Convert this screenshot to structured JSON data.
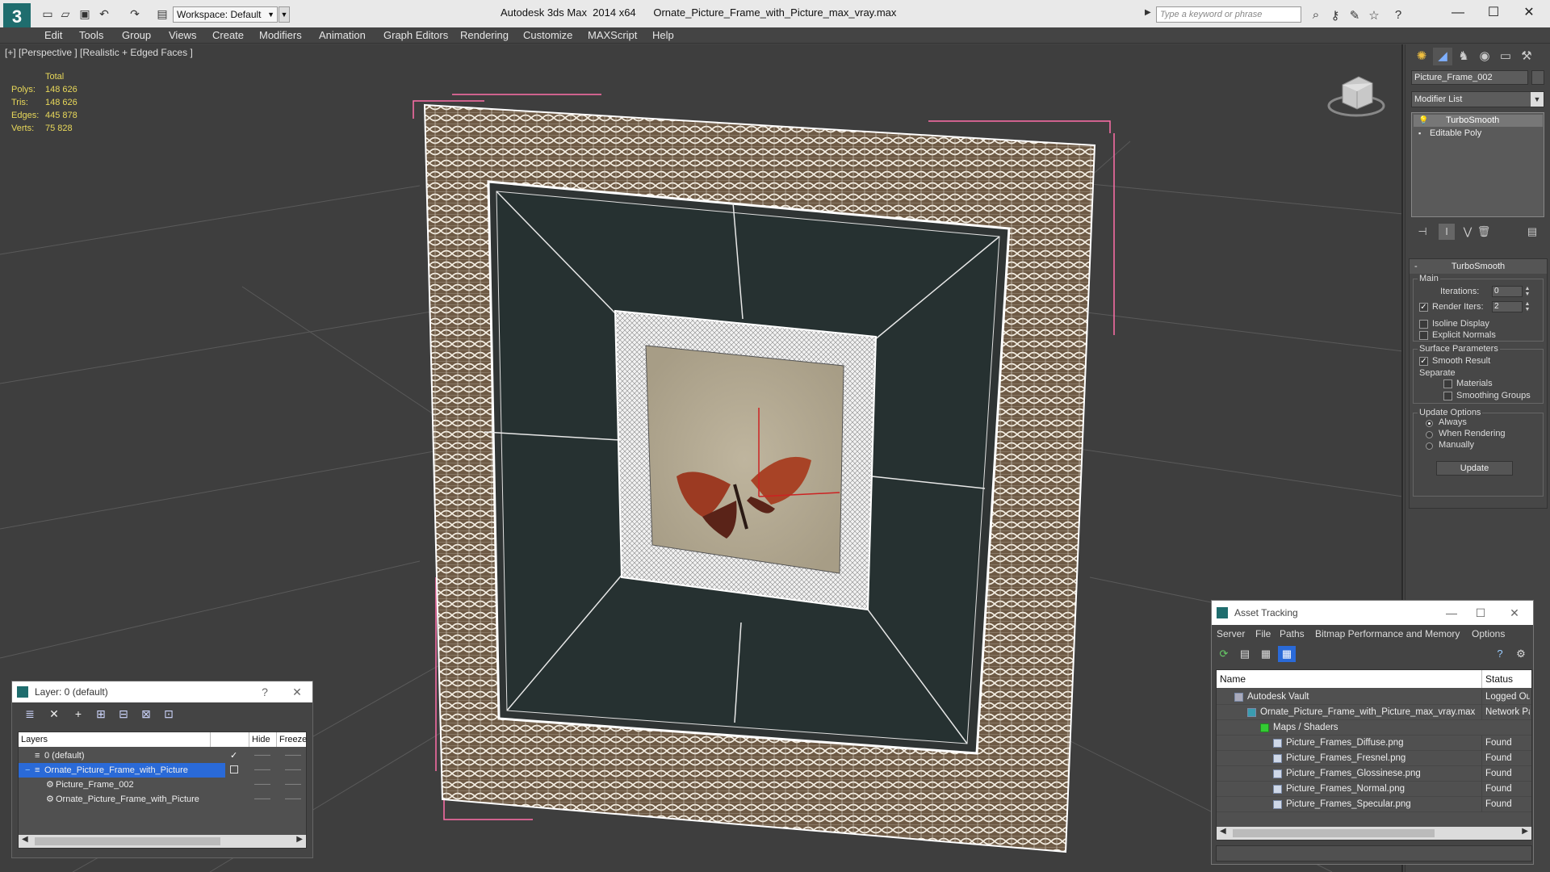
{
  "titlebar": {
    "workspace": "Workspace: Default",
    "app_name": "Autodesk 3ds Max  2014 x64",
    "file_name": "Ornate_Picture_Frame_with_Picture_max_vray.max",
    "search_placeholder": "Type a keyword or phrase"
  },
  "menu": [
    "Edit",
    "Tools",
    "Group",
    "Views",
    "Create",
    "Modifiers",
    "Animation",
    "Graph Editors",
    "Rendering",
    "Customize",
    "MAXScript",
    "Help"
  ],
  "viewport": {
    "label": "[+] [Perspective ] [Realistic + Edged Faces ]",
    "stats": {
      "total_label": "Total",
      "polys_label": "Polys:",
      "polys": "148 626",
      "tris_label": "Tris:",
      "tris": "148 626",
      "edges_label": "Edges:",
      "edges": "445 878",
      "verts_label": "Verts:",
      "verts": "75 828"
    }
  },
  "command_panel": {
    "object_name": "Picture_Frame_002",
    "modifier_list": "Modifier List",
    "stack": [
      "TurboSmooth",
      "Editable Poly"
    ],
    "rollout_title": "TurboSmooth",
    "main_label": "Main",
    "iterations_label": "Iterations:",
    "iterations": "0",
    "render_iters_label": "Render Iters:",
    "render_iters": "2",
    "isoline_label": "Isoline Display",
    "explicit_normals_label": "Explicit Normals",
    "surface_params_label": "Surface Parameters",
    "smooth_result_label": "Smooth Result",
    "separate_label": "Separate",
    "materials_label": "Materials",
    "smoothing_groups_label": "Smoothing Groups",
    "update_options_label": "Update Options",
    "always_label": "Always",
    "when_rendering_label": "When Rendering",
    "manually_label": "Manually",
    "update_button": "Update"
  },
  "layer_dialog": {
    "title": "Layer: 0 (default)",
    "columns": [
      "Layers",
      "Hide",
      "Freeze"
    ],
    "rows": [
      {
        "name": "0 (default)",
        "check": "✓"
      },
      {
        "name": "Ornate_Picture_Frame_with_Picture"
      },
      {
        "name": "Picture_Frame_002"
      },
      {
        "name": "Ornate_Picture_Frame_with_Picture"
      }
    ]
  },
  "asset_dialog": {
    "title": "Asset Tracking",
    "menu": [
      "Server",
      "File",
      "Paths",
      "Bitmap Performance and Memory",
      "Options"
    ],
    "columns": [
      "Name",
      "Status"
    ],
    "rows": [
      {
        "name": "Autodesk Vault",
        "status": "Logged Out"
      },
      {
        "name": "Ornate_Picture_Frame_with_Picture_max_vray.max",
        "status": "Network Path"
      },
      {
        "name": "Maps / Shaders",
        "status": ""
      },
      {
        "name": "Picture_Frames_Diffuse.png",
        "status": "Found"
      },
      {
        "name": "Picture_Frames_Fresnel.png",
        "status": "Found"
      },
      {
        "name": "Picture_Frames_Glossinese.png",
        "status": "Found"
      },
      {
        "name": "Picture_Frames_Normal.png",
        "status": "Found"
      },
      {
        "name": "Picture_Frames_Specular.png",
        "status": "Found"
      }
    ]
  },
  "colors": {
    "viewport_bg": "#3e3e3e",
    "selection": "#2a6ad8",
    "stats_text": "#e8d85a",
    "bbox": "#ff6fa8"
  }
}
